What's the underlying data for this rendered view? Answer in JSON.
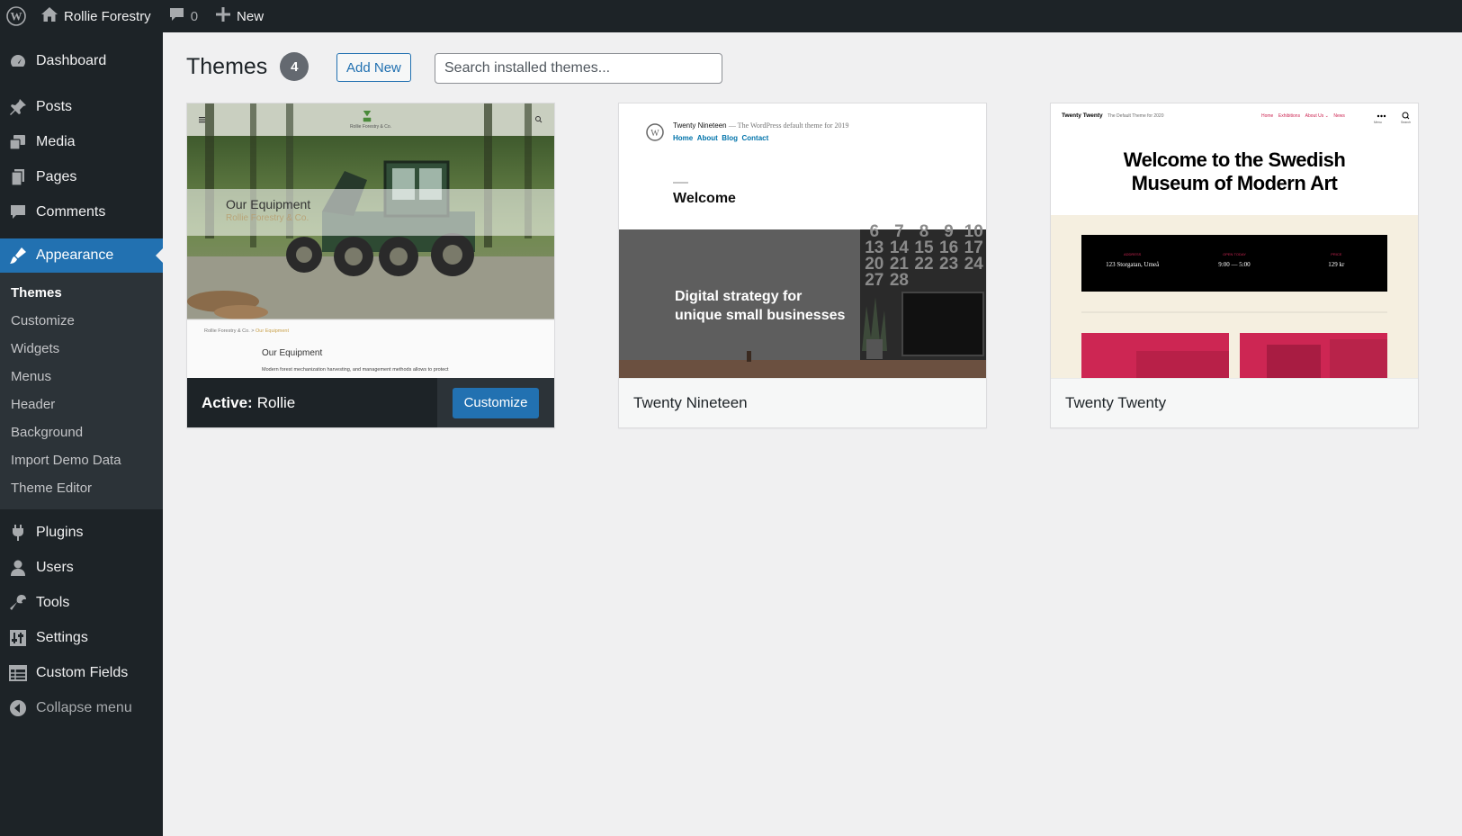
{
  "adminbar": {
    "site_name": "Rollie Forestry",
    "comments_count": "0",
    "new_label": "New"
  },
  "sidebar": {
    "items": [
      {
        "label": "Dashboard",
        "icon": "dashboard-icon"
      },
      {
        "label": "Posts",
        "icon": "pin-icon"
      },
      {
        "label": "Media",
        "icon": "media-icon"
      },
      {
        "label": "Pages",
        "icon": "pages-icon"
      },
      {
        "label": "Comments",
        "icon": "comment-icon"
      },
      {
        "label": "Appearance",
        "icon": "brush-icon"
      },
      {
        "label": "Plugins",
        "icon": "plug-icon"
      },
      {
        "label": "Users",
        "icon": "user-icon"
      },
      {
        "label": "Tools",
        "icon": "wrench-icon"
      },
      {
        "label": "Settings",
        "icon": "sliders-icon"
      },
      {
        "label": "Custom Fields",
        "icon": "table-icon"
      }
    ],
    "appearance_submenu": [
      "Themes",
      "Customize",
      "Widgets",
      "Menus",
      "Header",
      "Background",
      "Import Demo Data",
      "Theme Editor"
    ],
    "collapse_label": "Collapse menu"
  },
  "main": {
    "title": "Themes",
    "count": "4",
    "add_new": "Add New",
    "search_placeholder": "Search installed themes..."
  },
  "themes": [
    {
      "name": "Rollie",
      "active_prefix": "Active:",
      "customize": "Customize",
      "preview": {
        "brand": "Rollie Forestry & Co.",
        "hero_title": "Our Equipment",
        "hero_sub": "Rollie Forestry & Co.",
        "breadcrumb_home": "Rollie Forestry & Co.",
        "breadcrumb_sep": ">",
        "breadcrumb_current": "Our Equipment",
        "section_title": "Our Equipment",
        "section_text": "Modern forest mechanization harvesting, and management methods allows to protect"
      }
    },
    {
      "name": "Twenty Nineteen",
      "preview": {
        "site_title": "Twenty Nineteen",
        "tagline": "— The WordPress default theme for 2019",
        "nav": [
          "Home",
          "About",
          "Blog",
          "Contact"
        ],
        "welcome": "Welcome",
        "hero_line1": "Digital strategy for",
        "hero_line2": "unique small businesses",
        "calendar": [
          "6",
          "7",
          "8",
          "9",
          "10",
          "13",
          "14",
          "15",
          "16",
          "17",
          "20",
          "21",
          "22",
          "23",
          "24",
          "27",
          "28"
        ]
      }
    },
    {
      "name": "Twenty Twenty",
      "preview": {
        "site_title": "Twenty Twenty",
        "tagline": "The Default Theme for 2020",
        "nav": [
          "Home",
          "Exhibitions",
          "About Us ⌄",
          "News"
        ],
        "menu_label": "Menu",
        "search_label": "Search",
        "headline_line1": "Welcome to the Swedish",
        "headline_line2": "Museum of Modern Art",
        "info": [
          {
            "label": "ADDRESS",
            "value": "123 Storgatan, Umeå"
          },
          {
            "label": "OPEN TODAY",
            "value": "9:00 — 5:00"
          },
          {
            "label": "PRICE",
            "value": "129 kr"
          }
        ]
      }
    }
  ],
  "colors": {
    "adminbar": "#1d2327",
    "accent": "#2271b1",
    "background": "#f0f0f1",
    "tt_pink": "#cd2653"
  }
}
